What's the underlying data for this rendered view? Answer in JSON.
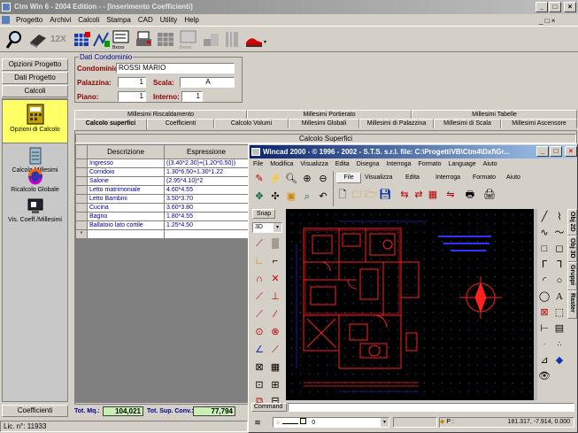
{
  "main_window": {
    "title": "Ctm Win 6 - 2004 Edition -  - [Inserimento Coefficienti]",
    "menu": [
      "Progetto",
      "Archivi",
      "Calcoli",
      "Stampa",
      "CAD",
      "Utility",
      "Help"
    ],
    "toolbar_text_badge": "12X"
  },
  "sidebar": {
    "top_buttons": [
      "Opzioni Progetto",
      "Dati Progetto",
      "Calcoli"
    ],
    "nav_items": [
      "Opzioni di Calcolo",
      "Calcola Millesimi",
      "Ricalcolo Globale",
      "Vis. Coeff./Millesimi"
    ],
    "bottom_button": "Coefficienti"
  },
  "dati_condominio": {
    "legend": "Dati Condominio",
    "condominio_label": "Condominio:",
    "condominio_value": "ROSSI MARIO",
    "palazzina_label": "Palazzina:",
    "palazzina_value": "1",
    "scala_label": "Scala:",
    "scala_value": "A",
    "piano_label": "Piano:",
    "piano_value": "1",
    "interno_label": "Interno:",
    "interno_value": "1"
  },
  "tabs_row1": [
    "Millesimi Riscaldamento",
    "Millesimi Portierato",
    "Millesimi Tabelle"
  ],
  "tabs_row2": [
    "Calcolo superfici",
    "Coefficienti",
    "Calcolo Volumi",
    "Millesimi Globali",
    "Millesimi di Palazzina",
    "Millesimi di Scala",
    "Millesimi Ascensore"
  ],
  "table": {
    "title": "Calcolo Superfici",
    "columns": [
      "Descrizione",
      "Espressione"
    ],
    "rows": [
      {
        "desc": "Ingresso",
        "expr": "((3.40*2.30)+(1.20*0.50))"
      },
      {
        "desc": "Corridoio",
        "expr": "1.30*6.50+1.30*1.22"
      },
      {
        "desc": "Salone",
        "expr": "(2.95*4.10)*2"
      },
      {
        "desc": "Letto matrimoniale",
        "expr": "4.60*4.55"
      },
      {
        "desc": "Letto Bambini",
        "expr": "3.50*3.70"
      },
      {
        "desc": "Cucina",
        "expr": "3.60*3.80"
      },
      {
        "desc": "Bagno",
        "expr": "1.80*4.55"
      },
      {
        "desc": "Ballatoio lato cortile",
        "expr": "1.25*4.50"
      }
    ],
    "new_row_marker": "*"
  },
  "totals": {
    "tot_mq_label": "Tot. Mq.:",
    "tot_mq_value": "104,021",
    "tot_sup_label": "Tot. Sup. Conv.:",
    "tot_sup_value": "77,794"
  },
  "statusbar": {
    "license": "Lic. n°: 11933"
  },
  "wincad": {
    "title": "Wincad 2000 -   © 1996 - 2002 - S.T.S. s.r.l. file: C:\\ProgettiVB\\Ctm4\\Dxf\\Gr...",
    "menu": [
      "File",
      "Modifica",
      "Visualizza",
      "Edita",
      "Disegna",
      "Interroga",
      "Formato",
      "Language",
      "Aiuto"
    ],
    "ribbon_tabs": [
      "File",
      "Visualizza",
      "Edita",
      "Interroga",
      "Formato",
      "Aiuto"
    ],
    "snap_label": "Snap",
    "view_select": "3D",
    "side_tabs": [
      "Obj 2D",
      "Obj 3D",
      "Gruppi",
      "Raster"
    ],
    "command_label": "Command",
    "layer_value": "0",
    "coord_label": "P :",
    "coordinates": "181.317, -7.914, 0.000",
    "text_glyph": "A",
    "colors": {
      "canvas": "#000000",
      "plan": "#ff2020",
      "annotation": "#3030ff",
      "grid": "#3050a0"
    }
  }
}
